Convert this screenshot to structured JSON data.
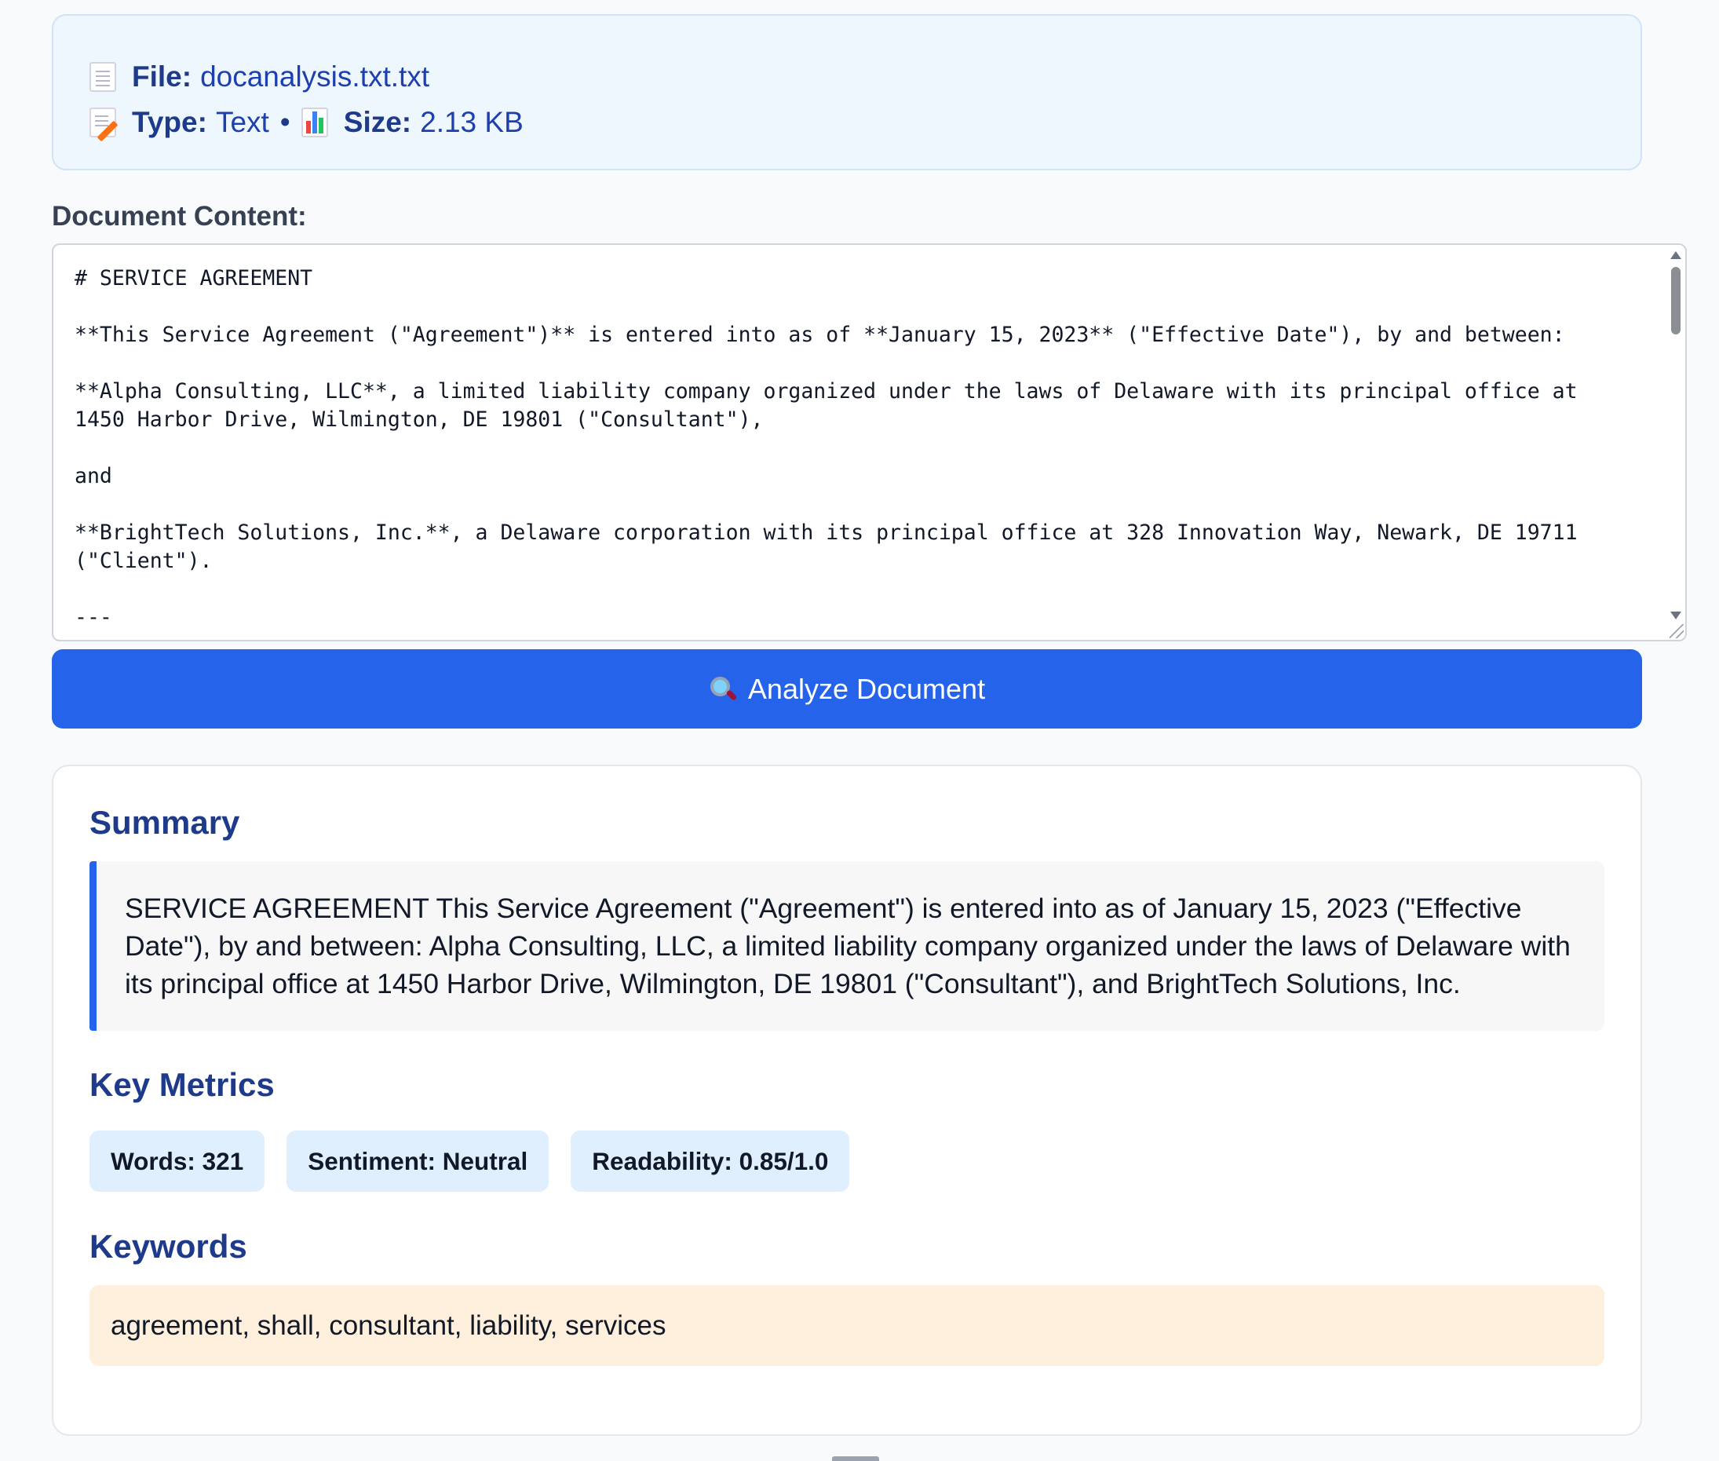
{
  "file_info": {
    "file_label": "File:",
    "file_name": "docanalysis.txt.txt",
    "type_label": "Type:",
    "type_value": "Text",
    "separator": "•",
    "size_label": "Size:",
    "size_value": "2.13 KB",
    "icons": [
      "document-icon",
      "memo-icon",
      "bar-chart-icon"
    ]
  },
  "document": {
    "label": "Document Content:",
    "content": "# SERVICE AGREEMENT\n\n**This Service Agreement (\"Agreement\")** is entered into as of **January 15, 2023** (\"Effective Date\"), by and between:\n\n**Alpha Consulting, LLC**, a limited liability company organized under the laws of Delaware with its principal office at 1450 Harbor Drive, Wilmington, DE 19801 (\"Consultant\"),\n\nand\n\n**BrightTech Solutions, Inc.**, a Delaware corporation with its principal office at 328 Innovation Way, Newark, DE 19711 (\"Client\").\n\n---"
  },
  "analyze_button": {
    "icon": "magnifier-icon",
    "label": "Analyze Document",
    "color": "#2563eb"
  },
  "results": {
    "summary_title": "Summary",
    "summary_text": "SERVICE AGREEMENT This Service Agreement (\"Agreement\") is entered into as of January 15, 2023 (\"Effective Date\"), by and between: Alpha Consulting, LLC, a limited liability company organized under the laws of Delaware with its principal office at 1450 Harbor Drive, Wilmington, DE 19801 (\"Consultant\"), and BrightTech Solutions, Inc.",
    "metrics_title": "Key Metrics",
    "metrics": [
      "Words: 321",
      "Sentiment: Neutral",
      "Readability: 0.85/1.0"
    ],
    "keywords_title": "Keywords",
    "keywords": "agreement, shall, consultant, liability, services"
  },
  "colors": {
    "accent": "#2563eb",
    "heading": "#1e3a8a",
    "metric_bg": "#e0effd",
    "keywords_bg": "#fef0dc",
    "file_card_bg": "#eef6fe"
  }
}
